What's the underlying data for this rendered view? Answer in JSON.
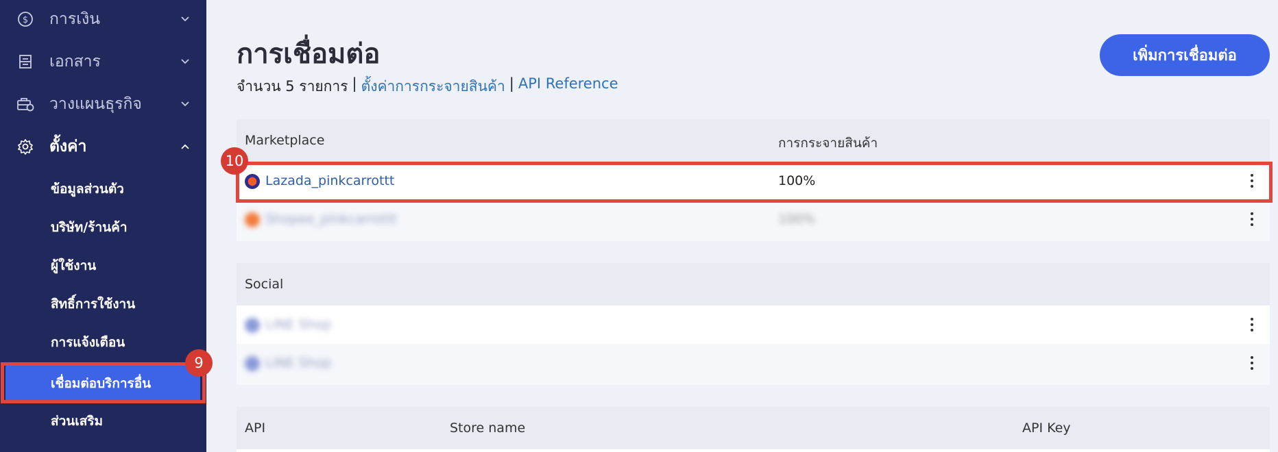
{
  "sidebar": {
    "items": [
      {
        "label": "การเงิน",
        "icon": "dollar-circle-icon"
      },
      {
        "label": "เอกสาร",
        "icon": "document-icon"
      },
      {
        "label": "วางแผนธุรกิจ",
        "icon": "briefcase-clock-icon"
      },
      {
        "label": "ตั้งค่า",
        "icon": "gear-icon"
      }
    ],
    "sub_items": [
      {
        "label": "ข้อมูลส่วนตัว"
      },
      {
        "label": "บริษัท/ร้านค้า"
      },
      {
        "label": "ผู้ใช้งาน"
      },
      {
        "label": "สิทธิ์การใช้งาน"
      },
      {
        "label": "การแจ้งเตือน"
      },
      {
        "label": "เชื่อมต่อบริการอื่น"
      },
      {
        "label": "ส่วนเสริม"
      }
    ],
    "step_badge": "9"
  },
  "main": {
    "title": "การเชื่อมต่อ",
    "summary": {
      "count_text": "จำนวน 5 รายการ",
      "separator": "|",
      "link_distribution": "ตั้งค่าการกระจายสินค้า",
      "link_api": "API Reference"
    },
    "add_button": "เพิ่มการเชื่อมต่อ",
    "marketplace": {
      "col_name": "Marketplace",
      "col_distribution": "การกระจายสินค้า",
      "rows": [
        {
          "name": "Lazada_pinkcarrottt",
          "distribution": "100%"
        },
        {
          "name": "Shopee_pinkcarrottt",
          "distribution": "100%"
        }
      ],
      "step_badge": "10"
    },
    "social": {
      "col_name": "Social",
      "rows": [
        {
          "name": "LINE Shop"
        },
        {
          "name": "LINE Shop"
        }
      ]
    },
    "api": {
      "col_api": "API",
      "col_store": "Store name",
      "col_key": "API Key"
    }
  },
  "colors": {
    "sidebar_bg": "#21295c",
    "accent": "#3d63e6",
    "highlight": "#e3463d",
    "link": "#2f72b5"
  }
}
